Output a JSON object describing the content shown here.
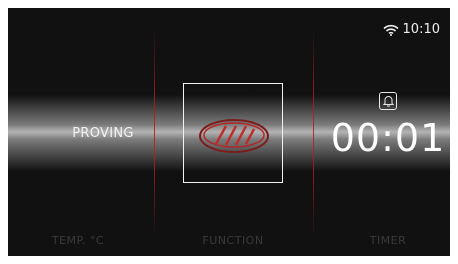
{
  "status_bar": {
    "time": "10:10",
    "wifi_icon": "wifi-icon"
  },
  "mode": {
    "label": "PROVING"
  },
  "function_panel": {
    "icon": "bread-proving-icon",
    "accent_color": "#c22a2a"
  },
  "timer": {
    "bell_icon": "bell-icon",
    "value": "00:01"
  },
  "footer": {
    "temp_label": "TEMP. °C",
    "function_label": "FUNCTION",
    "timer_label": "TIMER"
  }
}
